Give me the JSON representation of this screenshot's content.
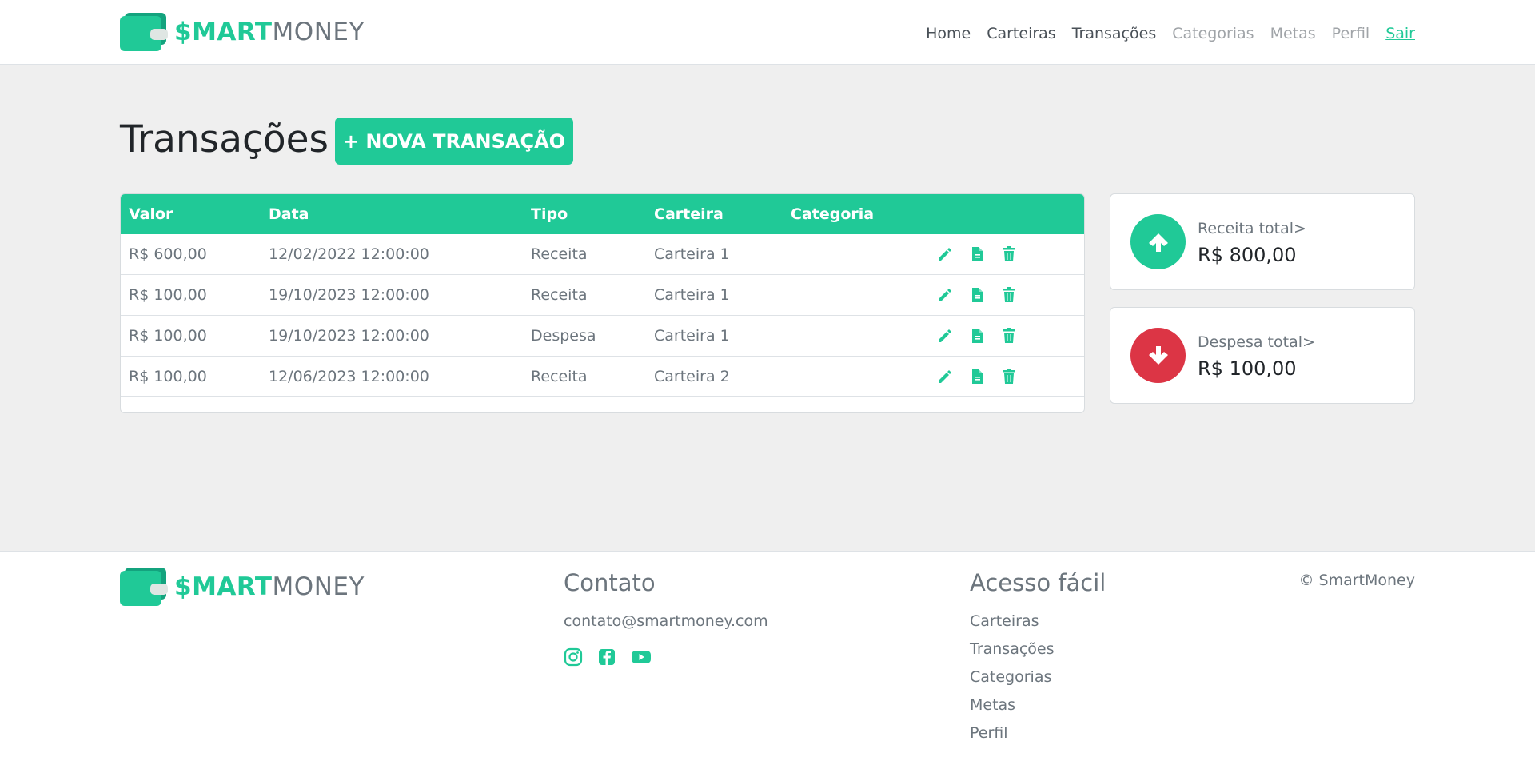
{
  "brand": {
    "smart": "$MART",
    "money": "MONEY"
  },
  "nav": [
    {
      "label": "Home"
    },
    {
      "label": "Carteiras"
    },
    {
      "label": "Transações"
    },
    {
      "label": "Categorias"
    },
    {
      "label": "Metas"
    },
    {
      "label": "Perfil"
    },
    {
      "label": "Sair"
    }
  ],
  "page": {
    "title": "Transações",
    "new_button": "+ NOVA TRANSAÇÃO"
  },
  "table": {
    "columns": [
      "Valor",
      "Data",
      "Tipo",
      "Carteira",
      "Categoria"
    ],
    "rows": [
      {
        "valor": "R$ 600,00",
        "data": "12/02/2022 12:00:00",
        "tipo": "Receita",
        "carteira": "Carteira 1",
        "categoria": ""
      },
      {
        "valor": "R$ 100,00",
        "data": "19/10/2023 12:00:00",
        "tipo": "Receita",
        "carteira": "Carteira 1",
        "categoria": ""
      },
      {
        "valor": "R$ 100,00",
        "data": "19/10/2023 12:00:00",
        "tipo": "Despesa",
        "carteira": "Carteira 1",
        "categoria": ""
      },
      {
        "valor": "R$ 100,00",
        "data": "12/06/2023 12:00:00",
        "tipo": "Receita",
        "carteira": "Carteira 2",
        "categoria": ""
      }
    ],
    "action_icons": [
      "pencil-icon",
      "document-icon",
      "trash-icon"
    ]
  },
  "summary": {
    "income": {
      "label": "Receita total>",
      "value": "R$ 800,00",
      "icon": "arrow-up-icon",
      "color": "#20c997"
    },
    "expense": {
      "label": "Despesa total>",
      "value": "R$ 100,00",
      "icon": "arrow-down-icon",
      "color": "#dc3545"
    }
  },
  "footer": {
    "contact_title": "Contato",
    "email": "contato@smartmoney.com",
    "social_icons": [
      "instagram-icon",
      "facebook-icon",
      "youtube-icon"
    ],
    "quick_title": "Acesso fácil",
    "quick_links": [
      "Carteiras",
      "Transações",
      "Categorias",
      "Metas",
      "Perfil"
    ],
    "copyright": "© SmartMoney"
  },
  "colors": {
    "accent": "#20c997",
    "danger": "#dc3545",
    "background": "#efefef"
  }
}
